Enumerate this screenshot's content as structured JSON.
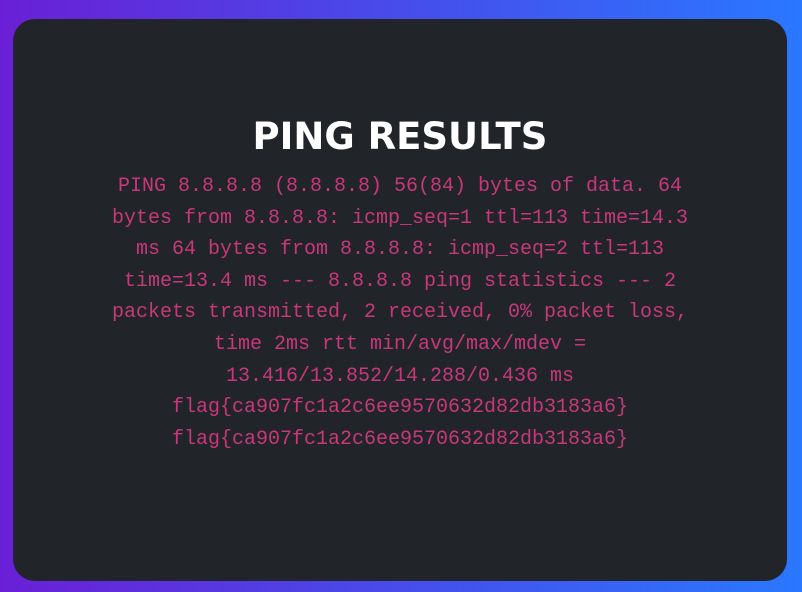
{
  "title": "PING RESULTS",
  "output_lines": [
    "PING 8.8.8.8 (8.8.8.8) 56(84) bytes of data. 64",
    "bytes from 8.8.8.8: icmp_seq=1 ttl=113 time=14.3",
    "ms 64 bytes from 8.8.8.8: icmp_seq=2 ttl=113",
    "time=13.4 ms --- 8.8.8.8 ping statistics --- 2",
    "packets transmitted, 2 received, 0% packet loss,",
    "time 2ms rtt min/avg/max/mdev =",
    "13.416/13.852/14.288/0.436 ms",
    "flag{ca907fc1a2c6ee9570632d82db3183a6}",
    "flag{ca907fc1a2c6ee9570632d82db3183a6}"
  ],
  "colors": {
    "background_start": "#6a1fd6",
    "background_end": "#2a78ff",
    "card": "#212429",
    "title": "#ffffff",
    "output_text": "#c7387b"
  }
}
